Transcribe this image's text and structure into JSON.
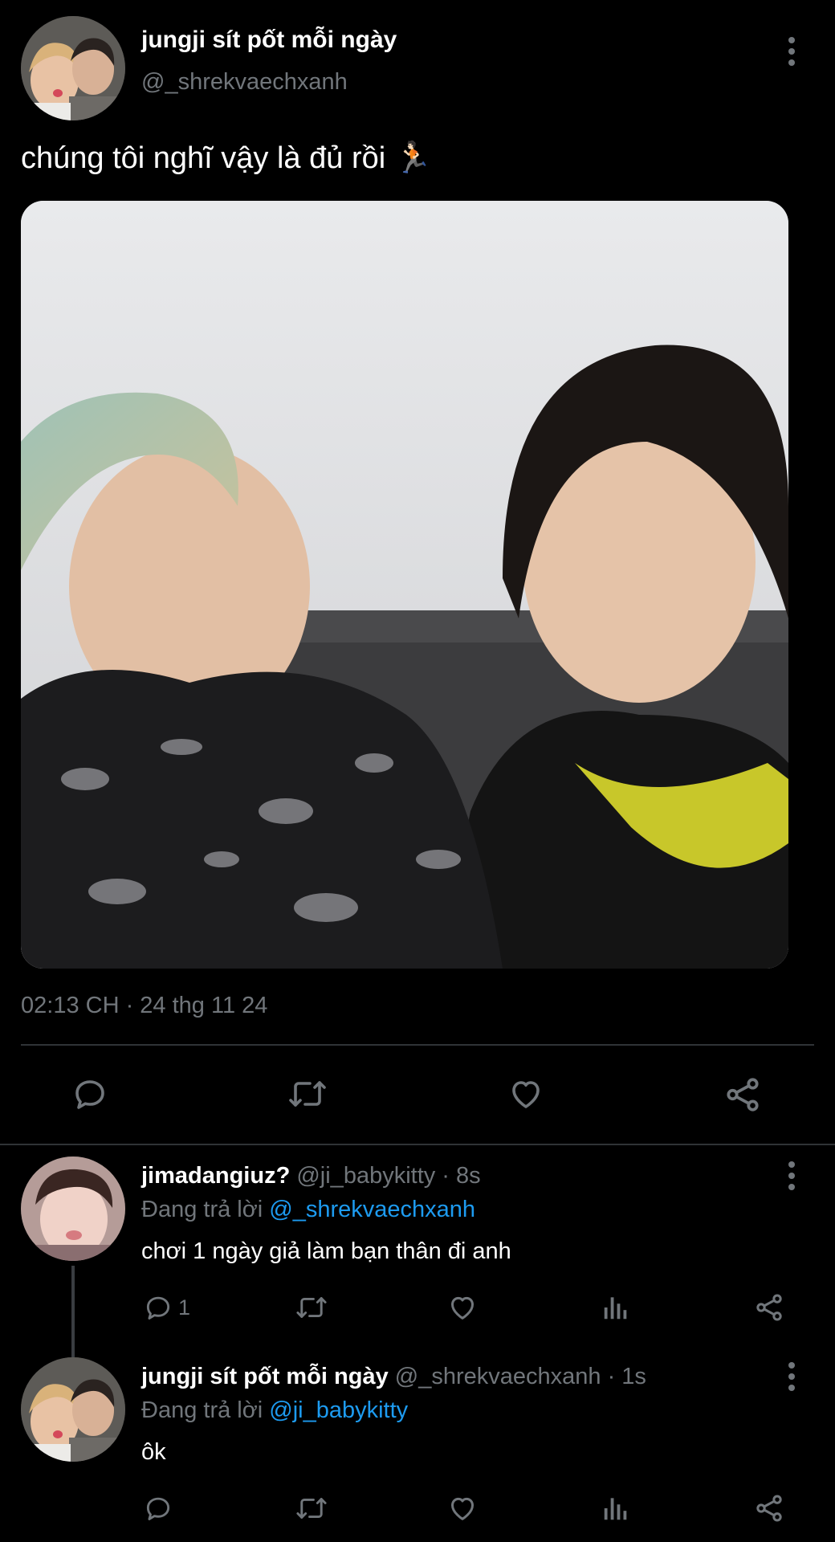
{
  "main_tweet": {
    "display_name": "jungji sít pốt mỗi ngày",
    "handle": "@_shrekvaechxanh",
    "text": "chúng tôi nghĩ vậy là đủ rồi 🏃🏻",
    "timestamp": "02:13 CH · 24 thg 11 24",
    "actions": [
      "reply-icon",
      "retweet-icon",
      "like-icon",
      "share-icon"
    ]
  },
  "replies": [
    {
      "display_name": "jimadangiuz?",
      "handle_time": "@ji_babykitty · 8s",
      "replying_prefix": "Đang trả lời",
      "replying_to": "@_shrekvaechxanh",
      "text": "chơi 1 ngày giả làm bạn thân đi anh",
      "reply_count": "1"
    },
    {
      "display_name": "jungji sít pốt mỗi ngày",
      "handle_time": "@_shrekvaechxanh · 1s",
      "replying_prefix": "Đang trả lời",
      "replying_to": "@ji_babykitty",
      "text": "ôk",
      "reply_count": ""
    }
  ],
  "colors": {
    "background": "#000000",
    "text": "#e7e9ea",
    "muted": "#71767b",
    "link": "#1d9bf0",
    "divider": "#2f3336"
  }
}
